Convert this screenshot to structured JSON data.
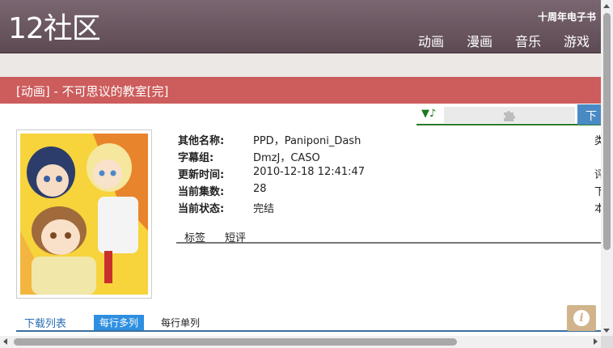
{
  "header": {
    "logo": "12社区",
    "top_link": "十周年电子书",
    "nav": [
      "动画",
      "漫画",
      "音乐",
      "游戏"
    ]
  },
  "title": "[动画] - 不可思议的教室[完]",
  "toolbar": {
    "play_glyph": "▼♪",
    "download_label": "下"
  },
  "info": {
    "rows": [
      {
        "label": "其他名称:",
        "value": "PPD，Paniponi_Dash",
        "right": "类"
      },
      {
        "label": "字幕组:",
        "value": "DmzJ，CASO",
        "right": ""
      },
      {
        "label": "更新时间:",
        "value": "2010-12-18 12:41:47",
        "right": "评"
      },
      {
        "label": "当前集数:",
        "value": "28",
        "right": "下"
      },
      {
        "label": "当前状态:",
        "value": "完结",
        "right": "本"
      }
    ]
  },
  "tabs": [
    "标签",
    "短评"
  ],
  "download_tabs": {
    "list": "下载列表",
    "multi": "每行多列",
    "single": "每行单列"
  },
  "info_button": "i",
  "colors": {
    "header": "#6b5761",
    "title_bar": "#cd5c5c",
    "accent_blue": "#2e8fe0"
  }
}
